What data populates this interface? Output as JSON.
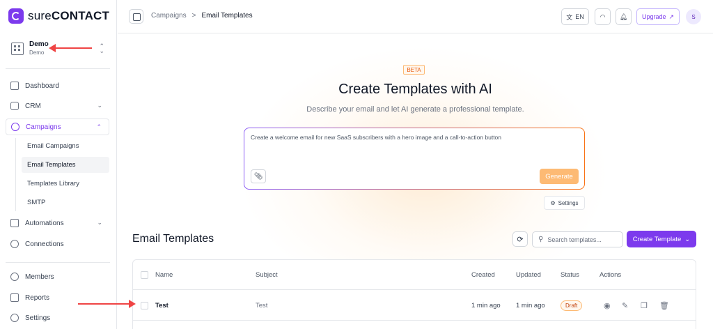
{
  "brand": {
    "name_bold": "sure",
    "name_rest": "CONTACT"
  },
  "workspace": {
    "name": "Demo",
    "sub": "Demo"
  },
  "nav": {
    "dashboard": "Dashboard",
    "crm": "CRM",
    "campaigns": "Campaigns",
    "sub": [
      "Email Campaigns",
      "Email Templates",
      "Templates Library",
      "SMTP"
    ],
    "automations": "Automations",
    "connections": "Connections",
    "members": "Members",
    "reports": "Reports",
    "settings": "Settings"
  },
  "header": {
    "breadcrumb": [
      "Campaigns",
      ">",
      "Email Templates"
    ],
    "language": "EN",
    "upgrade": "Upgrade",
    "avatar": "S"
  },
  "ai": {
    "badge": "BETA",
    "title": "Create Templates with AI",
    "subtitle": "Describe your email and let AI generate a professional template.",
    "prompt": "Create a welcome email for new SaaS subscribers with a hero image and a call-to-action button",
    "generate": "Generate",
    "settings": "Settings"
  },
  "templates": {
    "title": "Email Templates",
    "search_placeholder": "Search templates...",
    "create": "Create Template",
    "columns": [
      "Name",
      "Subject",
      "Created",
      "Updated",
      "Status",
      "Actions"
    ],
    "rows": [
      {
        "name": "Test",
        "subject": "Test",
        "created": "1 min ago",
        "updated": "1 min ago",
        "status": "Draft"
      }
    ]
  },
  "colors": {
    "accent": "#7c3aed",
    "annotation": "#ef4444",
    "generate": "#fdba74"
  }
}
